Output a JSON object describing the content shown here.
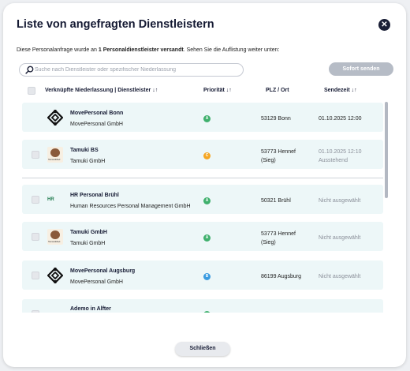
{
  "modal": {
    "title": "Liste von angefragten Dienstleistern",
    "subtitle_pre": "Diese Personalanfrage wurde an ",
    "subtitle_bold": "1 Personaldienstleister versandt",
    "subtitle_post": ". Sehen Sie die Auflistung weiter unten:",
    "close_glyph": "✕",
    "search_placeholder": "Suche nach Dienstleister oder spezifischer Niederlassung",
    "send_button": "Sofort senden",
    "close_button": "Schließen"
  },
  "columns": {
    "branch": "Verknüpfte Niederlassung | Dienstleister",
    "priority": "Priorität",
    "location": "PLZ / Ort",
    "sent": "Sendezeit",
    "sort_glyph": "↓↑"
  },
  "rows": [
    {
      "name": "MovePersonal Bonn",
      "company": "MovePersonal GmbH",
      "priority": "A",
      "priority_color": "#3fb06d",
      "plz1": "53129 Bonn",
      "plz2": "",
      "sent1": "01.10.2025 12:00",
      "sent2": "",
      "logo": "moveperson-logo-icon",
      "checkbox": false
    },
    {
      "name": "Tamuki BS",
      "company": "Tamuki GmbH",
      "priority": "C",
      "priority_color": "#f5a623",
      "plz1": "53773 Hennef",
      "plz2": "(Sieg)",
      "sent1": "01.10.2025 12:10",
      "sent2": "Ausstehend",
      "logo": "tamuki-logo-icon",
      "checkbox": true
    },
    {
      "name": "HR Personal Brühl",
      "company": "Human Resources Personal Management GmbH",
      "priority": "A",
      "priority_color": "#3fb06d",
      "plz1": "50321 Brühl",
      "plz2": "",
      "sent1": "Nicht ausgewählt",
      "sent2": "",
      "logo": "hr-logo-icon",
      "checkbox": true
    },
    {
      "name": "Tamuki GmbH",
      "company": "Tamuki GmbH",
      "priority": "A",
      "priority_color": "#3fb06d",
      "plz1": "53773 Hennef",
      "plz2": "(Sieg)",
      "sent1": "Nicht ausgewählt",
      "sent2": "",
      "logo": "tamuki-logo-icon",
      "checkbox": true
    },
    {
      "name": "MovePersonal Augsburg",
      "company": "MovePersonal GmbH",
      "priority": "B",
      "priority_color": "#3a9be0",
      "plz1": "86199 Augsburg",
      "plz2": "",
      "sent1": "Nicht ausgewählt",
      "sent2": "",
      "logo": "moveperson-logo-icon",
      "checkbox": true
    },
    {
      "name": "Ademo in Alfter",
      "company": "",
      "priority": "",
      "priority_color": "#3fb06d",
      "plz1": "",
      "plz2": "",
      "sent1": "",
      "sent2": "",
      "logo": "",
      "checkbox": true
    }
  ],
  "logos": {
    "hr_text": "HR",
    "tamuki_text": "TamukiMed"
  }
}
